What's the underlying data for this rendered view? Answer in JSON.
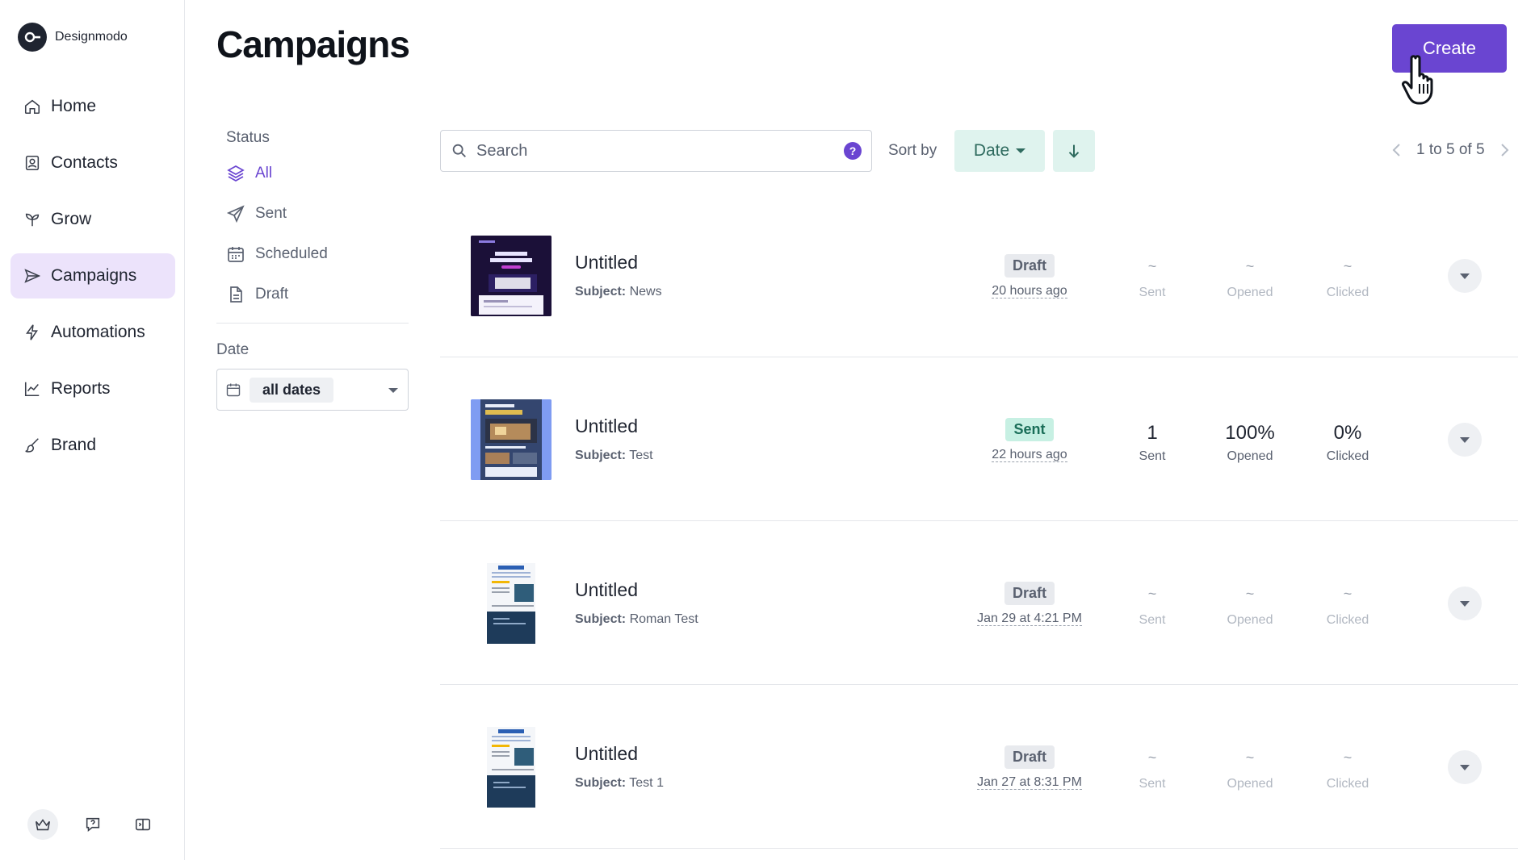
{
  "brand": {
    "name": "Designmodo"
  },
  "nav": {
    "items": [
      {
        "label": "Home",
        "icon": "home-icon"
      },
      {
        "label": "Contacts",
        "icon": "contacts-icon"
      },
      {
        "label": "Grow",
        "icon": "sprout-icon"
      },
      {
        "label": "Campaigns",
        "icon": "send-icon",
        "active": true
      },
      {
        "label": "Automations",
        "icon": "bolt-icon"
      },
      {
        "label": "Reports",
        "icon": "chart-icon"
      },
      {
        "label": "Brand",
        "icon": "brush-icon"
      }
    ]
  },
  "header": {
    "title": "Campaigns",
    "create_label": "Create"
  },
  "filters": {
    "status_heading": "Status",
    "items": [
      {
        "label": "All",
        "icon": "layers-icon",
        "active": true
      },
      {
        "label": "Sent",
        "icon": "paper-plane-icon"
      },
      {
        "label": "Scheduled",
        "icon": "calendar-icon"
      },
      {
        "label": "Draft",
        "icon": "document-icon"
      }
    ],
    "date_heading": "Date",
    "date_value": "all dates"
  },
  "toolbar": {
    "search_placeholder": "Search",
    "help": "?",
    "sort_label": "Sort by",
    "sort_value": "Date",
    "pagination": "1 to 5 of 5"
  },
  "campaigns": [
    {
      "title": "Untitled",
      "subject_label": "Subject:",
      "subject": "News",
      "status": "Draft",
      "time": "20 hours ago",
      "sent": "~",
      "opened": "~",
      "clicked": "~",
      "sent_label": "Sent",
      "opened_label": "Opened",
      "clicked_label": "Clicked"
    },
    {
      "title": "Untitled",
      "subject_label": "Subject:",
      "subject": "Test",
      "status": "Sent",
      "time": "22 hours ago",
      "sent": "1",
      "opened": "100%",
      "clicked": "0%",
      "sent_label": "Sent",
      "opened_label": "Opened",
      "clicked_label": "Clicked"
    },
    {
      "title": "Untitled",
      "subject_label": "Subject:",
      "subject": "Roman Test",
      "status": "Draft",
      "time": "Jan 29 at 4:21 PM",
      "sent": "~",
      "opened": "~",
      "clicked": "~",
      "sent_label": "Sent",
      "opened_label": "Opened",
      "clicked_label": "Clicked"
    },
    {
      "title": "Untitled",
      "subject_label": "Subject:",
      "subject": "Test 1",
      "status": "Draft",
      "time": "Jan 27 at 8:31 PM",
      "sent": "~",
      "opened": "~",
      "clicked": "~",
      "sent_label": "Sent",
      "opened_label": "Opened",
      "clicked_label": "Clicked"
    }
  ],
  "colors": {
    "accent": "#6a45d1",
    "active_nav_bg": "#ece3fb",
    "sort_bg": "#dff3ee",
    "sent_badge_bg": "#c7f0e3",
    "draft_badge_bg": "#e8eaee"
  }
}
